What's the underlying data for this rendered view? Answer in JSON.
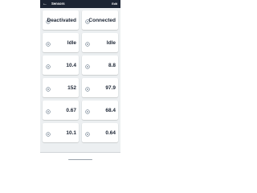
{
  "appbar": {
    "back_icon": "back-arrow-icon",
    "title": "Sensors",
    "edit_label": "Edit"
  },
  "cards": [
    {
      "label": "",
      "value": "Deactivated",
      "unit": "",
      "icon": "card-icon"
    },
    {
      "label": "",
      "value": "Connected",
      "unit": "",
      "icon": "card-icon"
    },
    {
      "label": "",
      "value": "Idle",
      "unit": "",
      "icon": "card-icon"
    },
    {
      "label": "",
      "value": "Idle",
      "unit": "",
      "icon": "card-icon"
    },
    {
      "label": "",
      "value": "10.4",
      "unit": "",
      "icon": "card-icon"
    },
    {
      "label": "",
      "value": "8.8",
      "unit": "",
      "icon": "card-icon"
    },
    {
      "label": "",
      "value": "152",
      "unit": "",
      "icon": "card-icon"
    },
    {
      "label": "",
      "value": "97.9",
      "unit": "",
      "icon": "card-icon"
    },
    {
      "label": "",
      "value": "0.67",
      "unit": "",
      "icon": "card-icon"
    },
    {
      "label": "",
      "value": "68.4",
      "unit": "",
      "icon": "card-icon"
    },
    {
      "label": "",
      "value": "10.1",
      "unit": "",
      "icon": "card-icon"
    },
    {
      "label": "",
      "value": "0.64",
      "unit": "",
      "icon": "card-icon"
    }
  ],
  "bottom_bar": {
    "text": ""
  },
  "colors": {
    "appbar": "#1b2433",
    "label": "#1aa1b9",
    "value": "#1b2433",
    "background": "#eceff1"
  }
}
